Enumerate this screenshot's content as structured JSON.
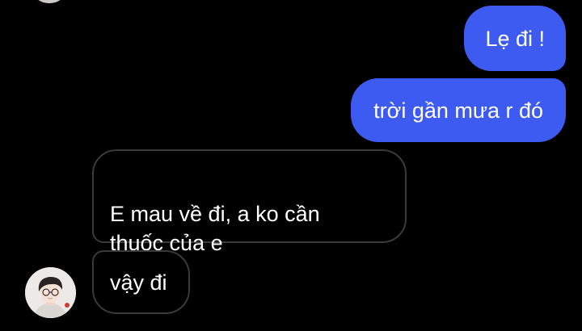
{
  "conversation": {
    "messages": [
      {
        "sender": "me",
        "text": "Lẹ đi !"
      },
      {
        "sender": "me",
        "text": "trời gần mưa r đó"
      },
      {
        "sender": "other",
        "text": "E mau về đi, a ko cần\nthuốc của e"
      },
      {
        "sender": "other",
        "text": "vậy đi"
      }
    ]
  },
  "colors": {
    "background": "#000000",
    "outgoing_bubble": "#3d5af1",
    "incoming_border": "#3a3a3a",
    "text": "#ffffff"
  },
  "icons": {
    "avatar": "contact-avatar-photo"
  }
}
